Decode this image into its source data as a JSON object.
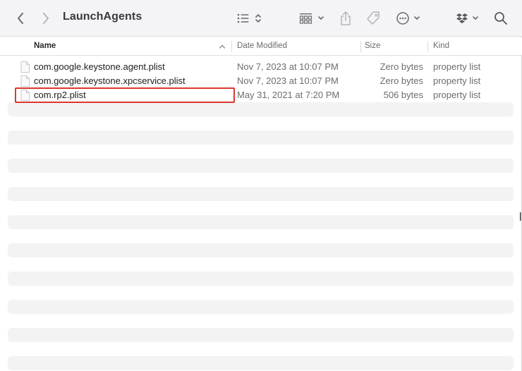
{
  "window": {
    "title": "LaunchAgents"
  },
  "toolbar": {
    "back_icon": "chevron-left-icon",
    "forward_icon": "chevron-right-icon",
    "view_list_icon": "list-view-icon",
    "group_icon": "grid-view-icon",
    "share_icon": "share-icon",
    "tag_icon": "tag-icon",
    "action_icon": "ellipsis-circle-icon",
    "dropbox_icon": "dropbox-icon",
    "search_icon": "search-icon"
  },
  "columns": {
    "name": "Name",
    "date": "Date Modified",
    "size": "Size",
    "kind": "Kind"
  },
  "files": [
    {
      "name": "com.google.keystone.agent.plist",
      "date": "Nov 7, 2023 at 10:07 PM",
      "size": "Zero bytes",
      "kind": "property list"
    },
    {
      "name": "com.google.keystone.xpcservice.plist",
      "date": "Nov 7, 2023 at 10:07 PM",
      "size": "Zero bytes",
      "kind": "property list"
    },
    {
      "name": "com.rp2.plist",
      "date": "May 31, 2021 at 7:20 PM",
      "size": "506 bytes",
      "kind": "property list"
    }
  ],
  "colors": {
    "highlight": "#d9382f",
    "stripe": "#f3f3f4",
    "toolbar_bg": "#f4f3f6"
  }
}
